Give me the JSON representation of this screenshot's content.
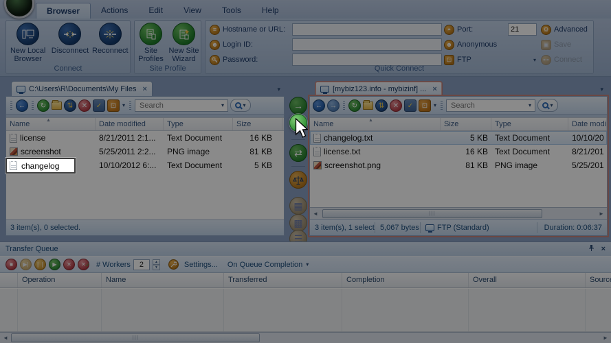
{
  "ribbon": {
    "tabs": [
      "Browser",
      "Actions",
      "Edit",
      "View",
      "Tools",
      "Help"
    ],
    "connect": {
      "label": "Connect",
      "new_local_browser": "New Local Browser",
      "disconnect": "Disconnect",
      "reconnect": "Reconnect"
    },
    "site_profile": {
      "label": "Site Profile",
      "site_profiles": "Site Profiles",
      "new_site_wizard": "New Site Wizard"
    },
    "quick_connect": {
      "label": "Quick Connect",
      "hostname_label": "Hostname or URL:",
      "login_label": "Login ID:",
      "password_label": "Password:",
      "port_label": "Port:",
      "port_value": "21",
      "advanced": "Advanced",
      "anonymous": "Anonymous",
      "save": "Save",
      "protocol": "FTP",
      "connect": "Connect"
    }
  },
  "left_pane": {
    "tab_title": "C:\\Users\\R\\Documents\\My Files",
    "search_placeholder": "Search",
    "columns": [
      "Name",
      "Date modified",
      "Type",
      "Size"
    ],
    "rows": [
      {
        "name": "license",
        "date": "8/21/2011 2:1...",
        "type": "Text Document",
        "size": "16 KB"
      },
      {
        "name": "screenshot",
        "date": "5/25/2011 2:2...",
        "type": "PNG image",
        "size": "81 KB"
      },
      {
        "name": "",
        "date": "10/10/2012 6:...",
        "type": "Text Document",
        "size": "5 KB"
      }
    ],
    "rename_value": "changelog",
    "status": "3 item(s), 0 selected."
  },
  "right_pane": {
    "tab_title": "[mybiz123.info - mybizinf] ...",
    "search_placeholder": "Search",
    "columns": [
      "Name",
      "Size",
      "Type",
      "Date modified"
    ],
    "rows": [
      {
        "name": "changelog.txt",
        "size": "5 KB",
        "type": "Text Document",
        "date": "10/10/20"
      },
      {
        "name": "license.txt",
        "size": "16 KB",
        "type": "Text Document",
        "date": "8/21/201"
      },
      {
        "name": "screenshot.png",
        "size": "81 KB",
        "type": "PNG image",
        "date": "5/25/201"
      }
    ],
    "status": {
      "items": "3 item(s), 1 select",
      "bytes": "5,067 bytes",
      "protocol": "FTP (Standard)",
      "duration": "Duration: 0:06:37"
    }
  },
  "queue": {
    "title": "Transfer Queue",
    "workers_label": "# Workers",
    "workers_value": "2",
    "settings": "Settings...",
    "completion": "On Queue Completion",
    "columns": [
      "Operation",
      "Name",
      "Transferred",
      "Completion",
      "Overall",
      "Source"
    ]
  },
  "colors": {
    "dim_overlay": "rgba(0,0,0,0.46)",
    "highlight_green": "#2e8f33",
    "active_pane_border": "#c4837c",
    "accent_blue": "#1f4e7c"
  }
}
